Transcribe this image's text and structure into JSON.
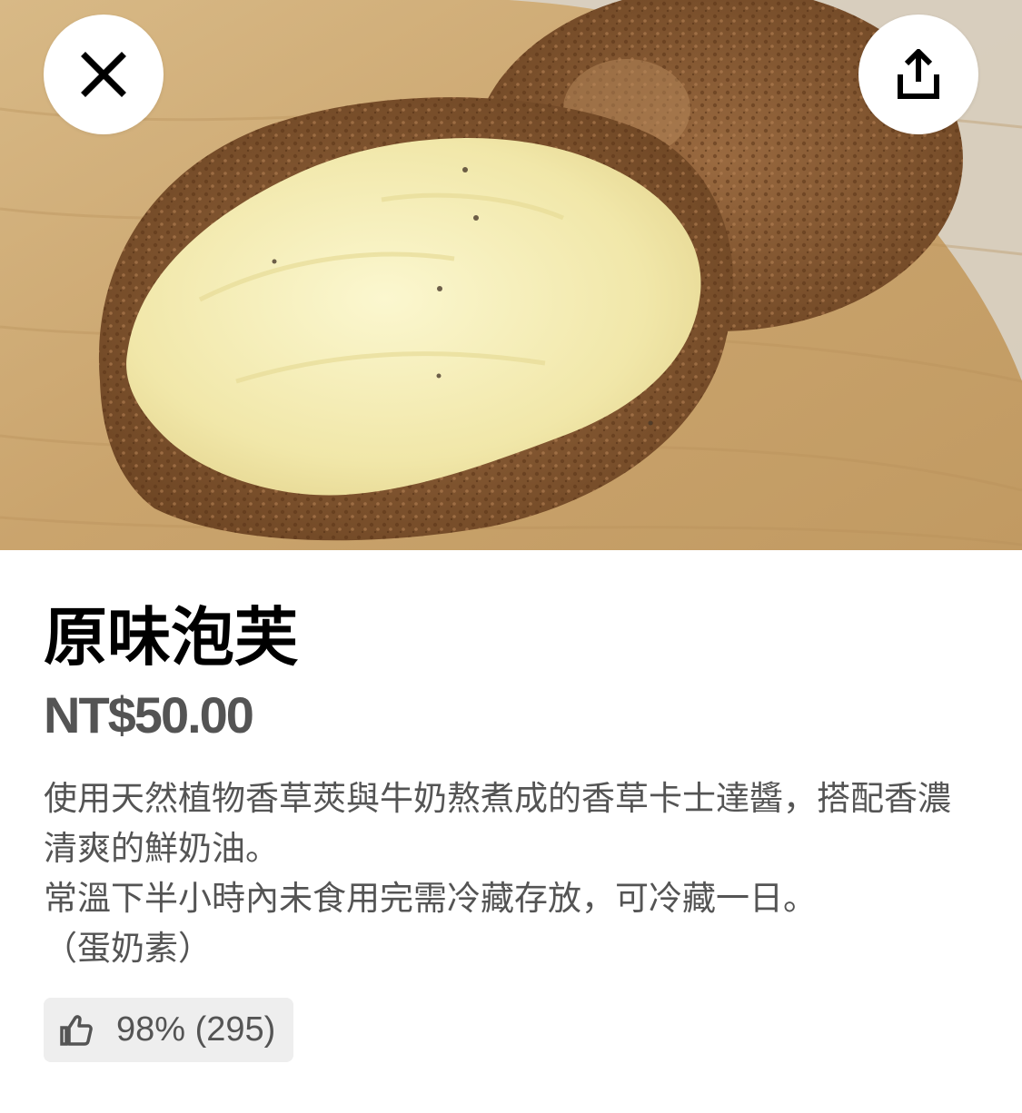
{
  "header": {
    "close_icon": "close-icon",
    "share_icon": "share-icon"
  },
  "hero": {
    "subject": "cream-puff-photo"
  },
  "item": {
    "title": "原味泡芙",
    "price": "NT$50.00",
    "description": "使用天然植物香草莢與牛奶熬煮成的香草卡士達醬，搭配香濃清爽的鮮奶油。\n常溫下半小時內未食用完需冷藏存放，可冷藏一日。\n（蛋奶素）",
    "rating": {
      "icon": "thumbs-up-icon",
      "text": "98% (295)"
    }
  },
  "colors": {
    "title": "#000000",
    "secondary_text": "#545454",
    "chip_background": "#eeeeee",
    "button_background": "#ffffff"
  }
}
